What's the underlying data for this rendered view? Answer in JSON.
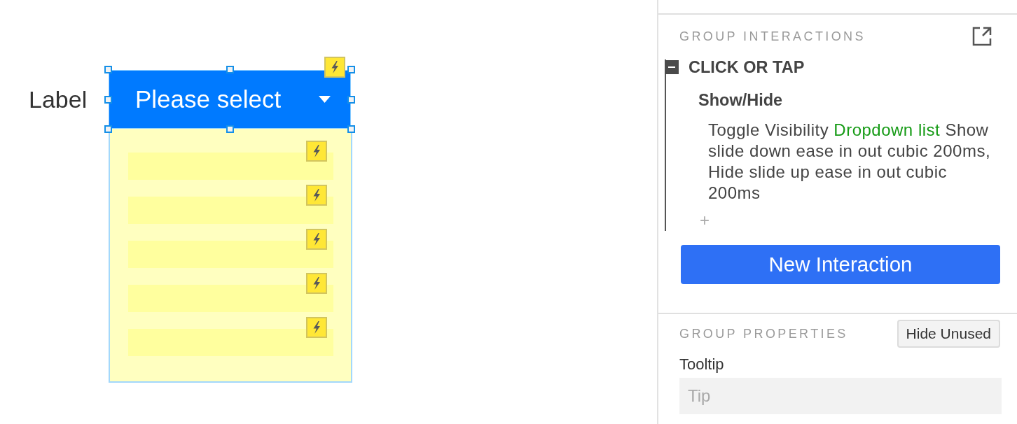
{
  "canvas": {
    "label": "Label",
    "dropdown": {
      "value": "Please select",
      "selected": true,
      "interaction": true
    },
    "list": {
      "items": [
        {
          "interaction": true
        },
        {
          "interaction": true
        },
        {
          "interaction": true
        },
        {
          "interaction": true
        },
        {
          "interaction": true
        }
      ]
    }
  },
  "panel": {
    "interactions": {
      "title": "GROUP INTERACTIONS",
      "events": [
        {
          "name": "CLICK OR TAP",
          "expanded": true,
          "actions": [
            {
              "name": "Show/Hide",
              "description": {
                "before": "Toggle Visibility",
                "target": "Dropdown list",
                "after": "Show slide down ease in out cubic 200ms, Hide slide up ease in out cubic 200ms"
              }
            }
          ],
          "add_action": "+"
        }
      ],
      "button": "New Interaction"
    },
    "properties": {
      "title": "GROUP PROPERTIES",
      "hide_button": "Hide Unused",
      "fields": [
        {
          "label": "Tooltip",
          "placeholder": "Tip"
        }
      ]
    }
  }
}
